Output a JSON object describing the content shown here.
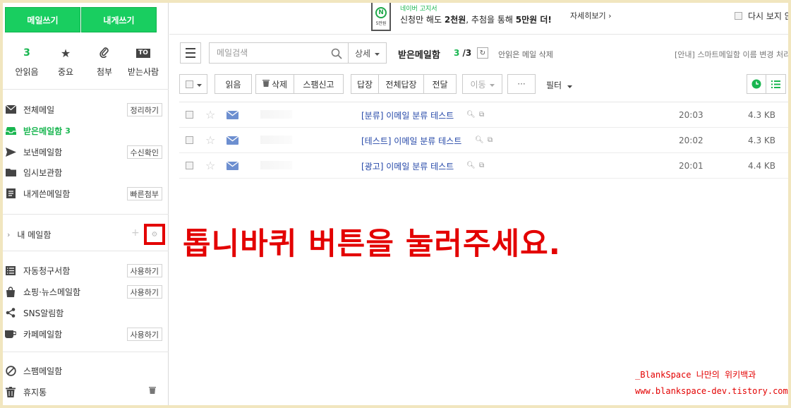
{
  "sidebar": {
    "compose_label": "메일쓰기",
    "self_compose_label": "내게쓰기",
    "quick": {
      "unread_count": "3",
      "unread_label": "안읽음",
      "important_label": "중요",
      "attach_label": "첨부",
      "to_badge": "TO",
      "recipient_label": "받는사람"
    },
    "folders": {
      "all": {
        "label": "전체메일",
        "action": "정리하기"
      },
      "inbox": {
        "label": "받은메일함",
        "count": "3"
      },
      "sent": {
        "label": "보낸메일함",
        "action": "수신확인"
      },
      "drafts": {
        "label": "임시보관함"
      },
      "self": {
        "label": "내게쓴메일함",
        "action": "빠른첨부"
      },
      "my_mail": {
        "label": "내 메일함"
      },
      "billing": {
        "label": "자동청구서함",
        "action": "사용하기"
      },
      "shopping": {
        "label": "쇼핑·뉴스메일함",
        "action": "사용하기"
      },
      "sns": {
        "label": "SNS알림함"
      },
      "cafe": {
        "label": "카페메일함",
        "action": "사용하기"
      },
      "spam": {
        "label": "스팸메일함"
      },
      "trash": {
        "label": "휴지통"
      }
    }
  },
  "ad": {
    "phone_amount": "5만원",
    "small": "네이버 고지서",
    "main_prefix": "신청만 해도 ",
    "main_bold1": "2천원",
    "main_mid": ", 추첨을 통해 ",
    "main_bold2": "5만원",
    "main_suffix": " 더!",
    "more": "자세히보기",
    "dont_show": "다시 보지 않음"
  },
  "search": {
    "placeholder": "메일검색",
    "detail_label": "상세"
  },
  "inbox": {
    "title": "받은메일함",
    "unread": "3",
    "total": "/3",
    "unread_delete": "안읽은 메일 삭제",
    "notice": "[안내] 스마트메일함 이름 변경 처리"
  },
  "toolbar": {
    "read": "읽음",
    "delete": "삭제",
    "spam": "스팸신고",
    "reply": "답장",
    "reply_all": "전체답장",
    "forward": "전달",
    "move": "이동",
    "more": "···",
    "filter": "필터"
  },
  "mails": [
    {
      "subject": "[분류] 이메일 분류 테스트",
      "time": "20:03",
      "size": "4.3 KB"
    },
    {
      "subject": "[테스트] 이메일 분류 테스트",
      "time": "20:02",
      "size": "4.3 KB"
    },
    {
      "subject": "[광고] 이메일 분류 테스트",
      "time": "20:01",
      "size": "4.4 KB"
    }
  ],
  "overlay": {
    "instruction": "톱니바퀴 버튼을 눌러주세요.",
    "watermark_line1": "_BlankSpace 나만의 위키백과",
    "watermark_line2": "www.blankspace-dev.tistory.com"
  },
  "colors": {
    "brand_green": "#19ce60",
    "annotation_red": "#e30000",
    "link_blue": "#2447a8",
    "frame_beige": "#f1e6bf"
  }
}
